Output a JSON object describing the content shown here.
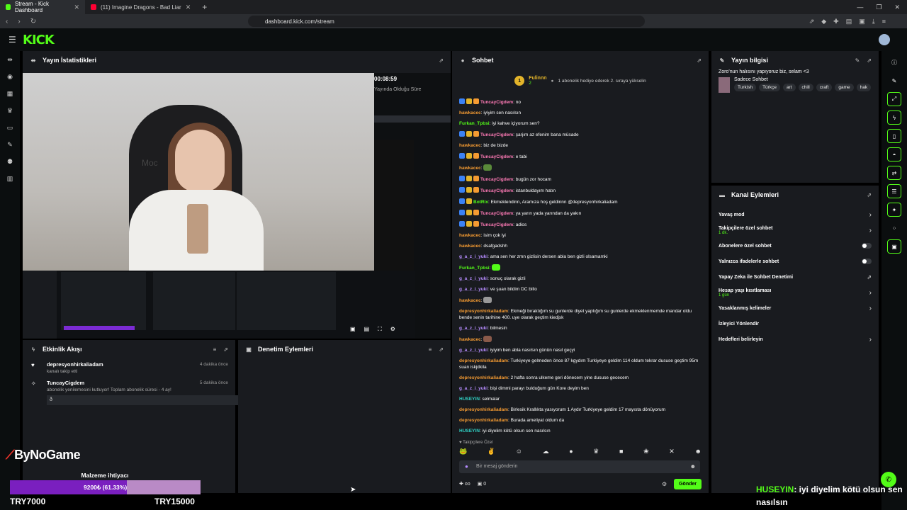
{
  "browser": {
    "tabs": [
      {
        "title": "Stream - Kick Dashboard",
        "active": true
      },
      {
        "title": "(11) Imagine Dragons - Bad Liar",
        "active": false
      }
    ],
    "url": "dashboard.kick.com/stream",
    "nav_icons": [
      "back-icon",
      "forward-icon",
      "reload-icon"
    ]
  },
  "app": {
    "logo": "KICK",
    "logo_color": "#53fc18"
  },
  "stats_panel": {
    "title": "Yayın İstatistikleri",
    "timer": "00:08:59",
    "timer_label": "Yayında Olduğu Süre",
    "webcam_wall_text": "Moc"
  },
  "activity_feed": {
    "title": "Etkinlik Akışı",
    "items": [
      {
        "user": "depresyonhirkaliadam",
        "desc": "kanalı takip etti",
        "when": "4 dakika önce",
        "icon": "heart-icon"
      },
      {
        "user": "TuncayCigdem",
        "desc": "abonelik yenilemesini kutluyor! Toplam abonelik süresi - 4 ay!",
        "when": "5 dakika önce",
        "icon": "star-icon",
        "message": "ð"
      }
    ]
  },
  "moderation": {
    "title": "Denetim Eylemleri"
  },
  "chat": {
    "title": "Sohbet",
    "pinned": {
      "badge": "1",
      "name": "Fulinnn",
      "sub": "2",
      "text": "1 abonelik hediye ederek 2. sıraya yükselin"
    },
    "messages": [
      {
        "user": "TuncayCigdem",
        "color": "pink",
        "badges": 3,
        "text": "no"
      },
      {
        "user": "hawkacec",
        "color": "orange",
        "badges": 0,
        "text": "iyiyim sen nasılsın"
      },
      {
        "user": "Furkan_Tpbsi",
        "color": "green",
        "badges": 0,
        "text": "iyi kahve içiyorum sen?"
      },
      {
        "user": "TuncayCigdem",
        "color": "pink",
        "badges": 3,
        "text": "şarjım az efenim bana müsade"
      },
      {
        "user": "hawkacec",
        "color": "orange",
        "badges": 0,
        "text": "biz de bizde"
      },
      {
        "user": "TuncayCigdem",
        "color": "pink",
        "badges": 3,
        "text": "e tabi"
      },
      {
        "user": "hawkacec",
        "color": "orange",
        "badges": 0,
        "text": "",
        "emote": "#5a8a3a"
      },
      {
        "user": "TuncayCigdem",
        "color": "pink",
        "badges": 3,
        "text": "bugün zor hocam"
      },
      {
        "user": "TuncayCigdem",
        "color": "pink",
        "badges": 3,
        "text": "istanbuldayım hatın"
      },
      {
        "user": "BotRix",
        "color": "green",
        "badges": 2,
        "text": "Ekmeklendinn, Aramıza hoş geldinnn @depresyonhirkaliadam"
      },
      {
        "user": "TuncayCigdem",
        "color": "pink",
        "badges": 3,
        "text": "ya yarın yada yarından da yakın"
      },
      {
        "user": "TuncayCigdem",
        "color": "pink",
        "badges": 3,
        "text": "adios"
      },
      {
        "user": "hawkacec",
        "color": "orange",
        "badges": 0,
        "text": "isim çok iyi"
      },
      {
        "user": "hawkacec",
        "color": "orange",
        "badges": 0,
        "text": "dsafgadshh"
      },
      {
        "user": "g_a_z_i_yuki",
        "color": "purple",
        "badges": 0,
        "text": "ama sen her zmn gizlisin dersen abla ben gizli olsamamki"
      },
      {
        "user": "Furkan_Tpbsi",
        "color": "green",
        "badges": 0,
        "text": "",
        "emote": "#53fc18"
      },
      {
        "user": "g_a_z_i_yuki",
        "color": "purple",
        "badges": 0,
        "text": "sonuç olarak gizli"
      },
      {
        "user": "g_a_z_i_yuki",
        "color": "purple",
        "badges": 0,
        "text": "ve şuan bildim DC billo"
      },
      {
        "user": "hawkacec",
        "color": "orange",
        "badges": 0,
        "text": "",
        "emote": "#999999"
      },
      {
        "user": "depresyonhirkaliadam",
        "color": "orange",
        "badges": 0,
        "text": "Ekmeği bıraktığım su gunlerde diyet yaptığım su gunlerde ekmeklenmemde mandar oldu bende senin tarihine 400. uye olarak geçtim kiedjsk"
      },
      {
        "user": "g_a_z_i_yuki",
        "color": "purple",
        "badges": 0,
        "text": "bilmesin"
      },
      {
        "user": "hawkacec",
        "color": "orange",
        "badges": 0,
        "text": "",
        "emote": "#8a5a4a"
      },
      {
        "user": "g_a_z_i_yuki",
        "color": "purple",
        "badges": 0,
        "text": "iyiyim ben abla nasılsın günün nasıl geçyi"
      },
      {
        "user": "depresyonhirkaliadam",
        "color": "orange",
        "badges": 0,
        "text": "Turkiyeye gelmeden önce 87 kgydım Turkiyeye geldim 114 oldum tekrar dususe geçtim 95m suan iskjdkila"
      },
      {
        "user": "depresyonhirkaliadam",
        "color": "orange",
        "badges": 0,
        "text": "2 hafta sonra ulkeme geri dönecem yine dususe gececem"
      },
      {
        "user": "g_a_z_i_yuki",
        "color": "purple",
        "badges": 0,
        "text": "bişi dimmi parayı bulduğum gün Kore deyim ben"
      },
      {
        "user": "HUSEYIN",
        "color": "teal",
        "badges": 0,
        "text": "selmalar"
      },
      {
        "user": "depresyonhirkaliadam",
        "color": "orange",
        "badges": 0,
        "text": "Birlesik Krallıkta yasıyorum 1 Aydır Turkiyeye geldim 17 mayısta dönüyorum"
      },
      {
        "user": "depresyonhirkaliadam",
        "color": "orange",
        "badges": 0,
        "text": "Burada ameliyat oldum da"
      },
      {
        "user": "HUSEYIN",
        "color": "teal",
        "badges": 0,
        "text": "iyi diyelim kötü olsun sen nasılsın"
      }
    ],
    "footer_label": "Takipçilere Özel",
    "input_placeholder": "Bir mesaj gönderin",
    "send_label": "Gönder",
    "viewers": "0",
    "bottom_link": "oo"
  },
  "stream_info": {
    "title": "Yayın bilgisi",
    "stream_title": "Zoro'nun halısını yapıyoruz biz, selam <3",
    "category": "Sadece Sohbet",
    "tags": [
      "Turkish",
      "Türkçe",
      "art",
      "chill",
      "craft",
      "game",
      "hak"
    ]
  },
  "channel_actions": {
    "title": "Kanal Eylemleri",
    "items": [
      {
        "label": "Yavaş mod",
        "sub": "",
        "control": "chevron"
      },
      {
        "label": "Takipçilere özel sohbet",
        "sub": "1 dk.",
        "control": "chevron"
      },
      {
        "label": "Abonelere özel sohbet",
        "sub": "",
        "control": "toggle"
      },
      {
        "label": "Yalnızca ifadelerle sohbet",
        "sub": "",
        "control": "toggle"
      },
      {
        "label": "Yapay Zeka ile Sohbet Denetimi",
        "sub": "",
        "control": "external"
      },
      {
        "label": "Hesap yaşı kısıtlaması",
        "sub": "1 gün",
        "control": "chevron"
      },
      {
        "label": "Yasaklanmış kelimeler",
        "sub": "",
        "control": "chevron"
      },
      {
        "label": "İzleyici Yönlendir",
        "sub": "",
        "control": "none"
      },
      {
        "label": "Hedefleri belirleyin",
        "sub": "",
        "control": "chevron"
      }
    ]
  },
  "overlay": {
    "brand": "ByNoGame",
    "goal_title": "Malzeme ihtiyacı",
    "goal_value": "9200₺ (61.33%)",
    "goal_fraction": 0.6133,
    "goal_min": "TRY7000",
    "goal_max": "TRY15000",
    "ticker_user": "HUSEYIN",
    "ticker_text": ": iyi diyelim kötü olsun sen nasılsın"
  }
}
